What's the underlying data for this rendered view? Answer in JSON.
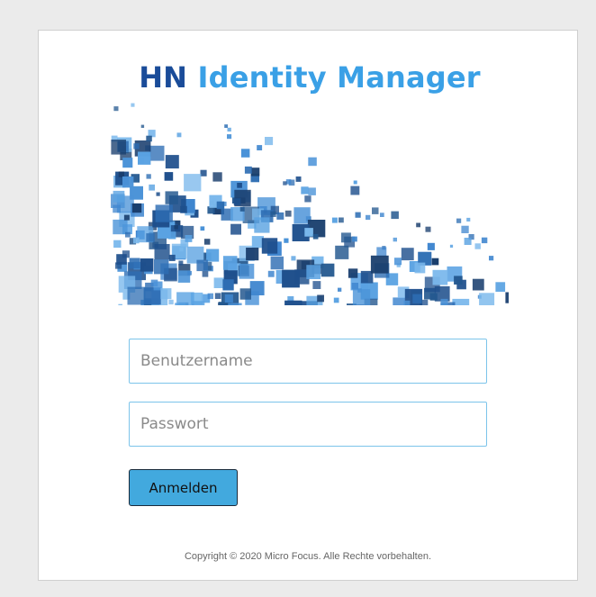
{
  "banner": {
    "title_prefix": "HN",
    "title_rest": "Identity Manager",
    "colors": {
      "prefix": "#1a4c99",
      "rest": "#3aa0e6",
      "cubes": "#2d6db3"
    }
  },
  "form": {
    "username_placeholder": "Benutzername",
    "username_value": "",
    "password_placeholder": "Passwort",
    "password_value": "",
    "login_label": "Anmelden"
  },
  "footer": {
    "copyright": "Copyright © 2020 Micro Focus. Alle Rechte vorbehalten."
  }
}
